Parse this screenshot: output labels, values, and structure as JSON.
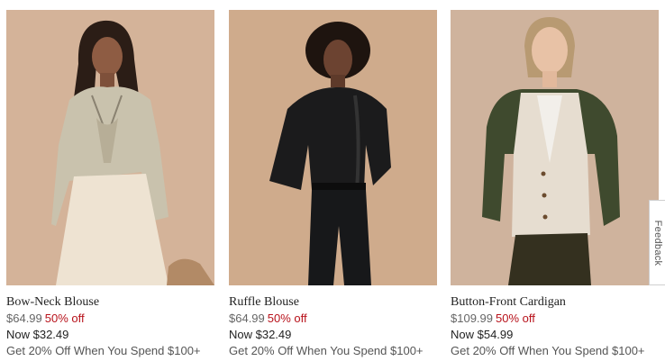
{
  "products": [
    {
      "name": "Bow-Neck Blouse",
      "original_price": "$64.99",
      "discount": "50% off",
      "now_price": "Now $32.49",
      "promo": "Get 20% Off When You Spend $100+"
    },
    {
      "name": "Ruffle Blouse",
      "original_price": "$64.99",
      "discount": "50% off",
      "now_price": "Now $32.49",
      "promo": "Get 20% Off When You Spend $100+"
    },
    {
      "name": "Button-Front Cardigan",
      "original_price": "$109.99",
      "discount": "50% off",
      "now_price": "Now $54.99",
      "promo": "Get 20% Off When You Spend $100+"
    }
  ],
  "feedback_tab": {
    "label": "Feedback"
  },
  "colors": {
    "discount": "#b8121b",
    "original_price": "#666666",
    "text": "#222222"
  }
}
